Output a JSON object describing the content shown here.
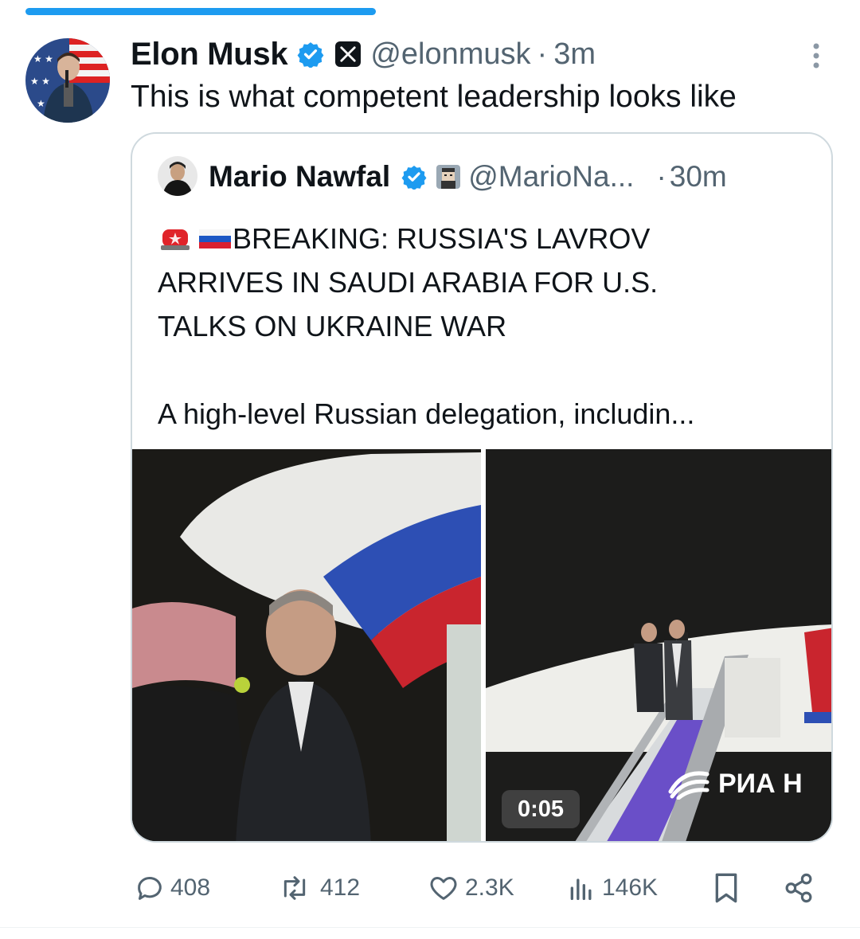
{
  "progress": {
    "fraction": 0.42
  },
  "tweet": {
    "author_name": "Elon Musk",
    "handle": "@elonmusk",
    "separator": "·",
    "time": "3m",
    "text": "This is what competent leadership looks like"
  },
  "quote": {
    "author_name": "Mario Nawfal",
    "handle": "@MarioNa...",
    "separator": "·",
    "time": "30m",
    "lines": [
      "BREAKING: RUSSIA'S LAVROV",
      "ARRIVES IN SAUDI ARABIA FOR U.S.",
      "TALKS ON UKRAINE WAR",
      "A high-level Russian delegation, includin..."
    ],
    "emojis": [
      "police-light-emoji",
      "russia-flag-emoji"
    ],
    "video_duration": "0:05",
    "watermark": "РИА Н"
  },
  "actions": {
    "replies": "408",
    "reposts": "412",
    "likes": "2.3K",
    "views": "146K"
  },
  "colors": {
    "accent": "#1d9bf0",
    "muted": "#536471",
    "text": "#0f1419",
    "border": "#cfd9de"
  }
}
